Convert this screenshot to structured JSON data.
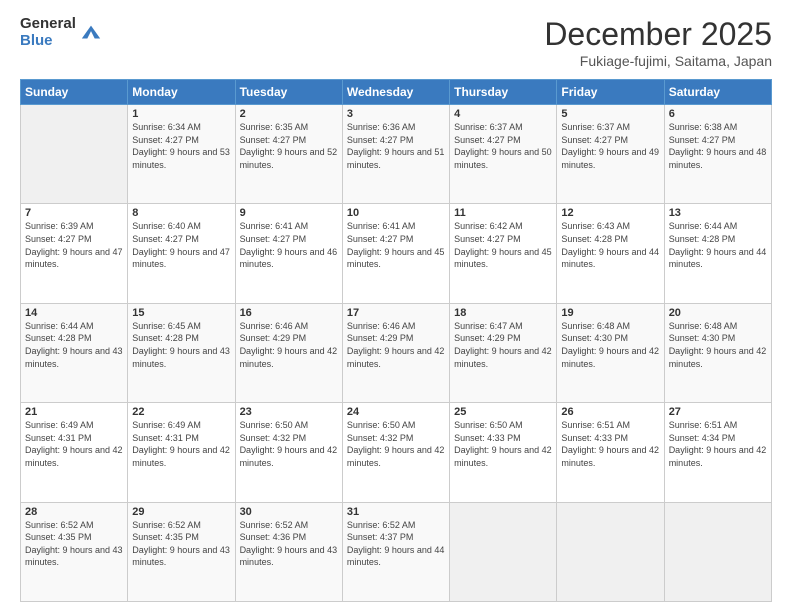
{
  "logo": {
    "general": "General",
    "blue": "Blue"
  },
  "header": {
    "month": "December 2025",
    "location": "Fukiage-fujimi, Saitama, Japan"
  },
  "weekdays": [
    "Sunday",
    "Monday",
    "Tuesday",
    "Wednesday",
    "Thursday",
    "Friday",
    "Saturday"
  ],
  "weeks": [
    [
      {
        "day": "",
        "sunrise": "",
        "sunset": "",
        "daylight": ""
      },
      {
        "day": "1",
        "sunrise": "Sunrise: 6:34 AM",
        "sunset": "Sunset: 4:27 PM",
        "daylight": "Daylight: 9 hours and 53 minutes."
      },
      {
        "day": "2",
        "sunrise": "Sunrise: 6:35 AM",
        "sunset": "Sunset: 4:27 PM",
        "daylight": "Daylight: 9 hours and 52 minutes."
      },
      {
        "day": "3",
        "sunrise": "Sunrise: 6:36 AM",
        "sunset": "Sunset: 4:27 PM",
        "daylight": "Daylight: 9 hours and 51 minutes."
      },
      {
        "day": "4",
        "sunrise": "Sunrise: 6:37 AM",
        "sunset": "Sunset: 4:27 PM",
        "daylight": "Daylight: 9 hours and 50 minutes."
      },
      {
        "day": "5",
        "sunrise": "Sunrise: 6:37 AM",
        "sunset": "Sunset: 4:27 PM",
        "daylight": "Daylight: 9 hours and 49 minutes."
      },
      {
        "day": "6",
        "sunrise": "Sunrise: 6:38 AM",
        "sunset": "Sunset: 4:27 PM",
        "daylight": "Daylight: 9 hours and 48 minutes."
      }
    ],
    [
      {
        "day": "7",
        "sunrise": "Sunrise: 6:39 AM",
        "sunset": "Sunset: 4:27 PM",
        "daylight": "Daylight: 9 hours and 47 minutes."
      },
      {
        "day": "8",
        "sunrise": "Sunrise: 6:40 AM",
        "sunset": "Sunset: 4:27 PM",
        "daylight": "Daylight: 9 hours and 47 minutes."
      },
      {
        "day": "9",
        "sunrise": "Sunrise: 6:41 AM",
        "sunset": "Sunset: 4:27 PM",
        "daylight": "Daylight: 9 hours and 46 minutes."
      },
      {
        "day": "10",
        "sunrise": "Sunrise: 6:41 AM",
        "sunset": "Sunset: 4:27 PM",
        "daylight": "Daylight: 9 hours and 45 minutes."
      },
      {
        "day": "11",
        "sunrise": "Sunrise: 6:42 AM",
        "sunset": "Sunset: 4:27 PM",
        "daylight": "Daylight: 9 hours and 45 minutes."
      },
      {
        "day": "12",
        "sunrise": "Sunrise: 6:43 AM",
        "sunset": "Sunset: 4:28 PM",
        "daylight": "Daylight: 9 hours and 44 minutes."
      },
      {
        "day": "13",
        "sunrise": "Sunrise: 6:44 AM",
        "sunset": "Sunset: 4:28 PM",
        "daylight": "Daylight: 9 hours and 44 minutes."
      }
    ],
    [
      {
        "day": "14",
        "sunrise": "Sunrise: 6:44 AM",
        "sunset": "Sunset: 4:28 PM",
        "daylight": "Daylight: 9 hours and 43 minutes."
      },
      {
        "day": "15",
        "sunrise": "Sunrise: 6:45 AM",
        "sunset": "Sunset: 4:28 PM",
        "daylight": "Daylight: 9 hours and 43 minutes."
      },
      {
        "day": "16",
        "sunrise": "Sunrise: 6:46 AM",
        "sunset": "Sunset: 4:29 PM",
        "daylight": "Daylight: 9 hours and 42 minutes."
      },
      {
        "day": "17",
        "sunrise": "Sunrise: 6:46 AM",
        "sunset": "Sunset: 4:29 PM",
        "daylight": "Daylight: 9 hours and 42 minutes."
      },
      {
        "day": "18",
        "sunrise": "Sunrise: 6:47 AM",
        "sunset": "Sunset: 4:29 PM",
        "daylight": "Daylight: 9 hours and 42 minutes."
      },
      {
        "day": "19",
        "sunrise": "Sunrise: 6:48 AM",
        "sunset": "Sunset: 4:30 PM",
        "daylight": "Daylight: 9 hours and 42 minutes."
      },
      {
        "day": "20",
        "sunrise": "Sunrise: 6:48 AM",
        "sunset": "Sunset: 4:30 PM",
        "daylight": "Daylight: 9 hours and 42 minutes."
      }
    ],
    [
      {
        "day": "21",
        "sunrise": "Sunrise: 6:49 AM",
        "sunset": "Sunset: 4:31 PM",
        "daylight": "Daylight: 9 hours and 42 minutes."
      },
      {
        "day": "22",
        "sunrise": "Sunrise: 6:49 AM",
        "sunset": "Sunset: 4:31 PM",
        "daylight": "Daylight: 9 hours and 42 minutes."
      },
      {
        "day": "23",
        "sunrise": "Sunrise: 6:50 AM",
        "sunset": "Sunset: 4:32 PM",
        "daylight": "Daylight: 9 hours and 42 minutes."
      },
      {
        "day": "24",
        "sunrise": "Sunrise: 6:50 AM",
        "sunset": "Sunset: 4:32 PM",
        "daylight": "Daylight: 9 hours and 42 minutes."
      },
      {
        "day": "25",
        "sunrise": "Sunrise: 6:50 AM",
        "sunset": "Sunset: 4:33 PM",
        "daylight": "Daylight: 9 hours and 42 minutes."
      },
      {
        "day": "26",
        "sunrise": "Sunrise: 6:51 AM",
        "sunset": "Sunset: 4:33 PM",
        "daylight": "Daylight: 9 hours and 42 minutes."
      },
      {
        "day": "27",
        "sunrise": "Sunrise: 6:51 AM",
        "sunset": "Sunset: 4:34 PM",
        "daylight": "Daylight: 9 hours and 42 minutes."
      }
    ],
    [
      {
        "day": "28",
        "sunrise": "Sunrise: 6:52 AM",
        "sunset": "Sunset: 4:35 PM",
        "daylight": "Daylight: 9 hours and 43 minutes."
      },
      {
        "day": "29",
        "sunrise": "Sunrise: 6:52 AM",
        "sunset": "Sunset: 4:35 PM",
        "daylight": "Daylight: 9 hours and 43 minutes."
      },
      {
        "day": "30",
        "sunrise": "Sunrise: 6:52 AM",
        "sunset": "Sunset: 4:36 PM",
        "daylight": "Daylight: 9 hours and 43 minutes."
      },
      {
        "day": "31",
        "sunrise": "Sunrise: 6:52 AM",
        "sunset": "Sunset: 4:37 PM",
        "daylight": "Daylight: 9 hours and 44 minutes."
      },
      {
        "day": "",
        "sunrise": "",
        "sunset": "",
        "daylight": ""
      },
      {
        "day": "",
        "sunrise": "",
        "sunset": "",
        "daylight": ""
      },
      {
        "day": "",
        "sunrise": "",
        "sunset": "",
        "daylight": ""
      }
    ]
  ]
}
